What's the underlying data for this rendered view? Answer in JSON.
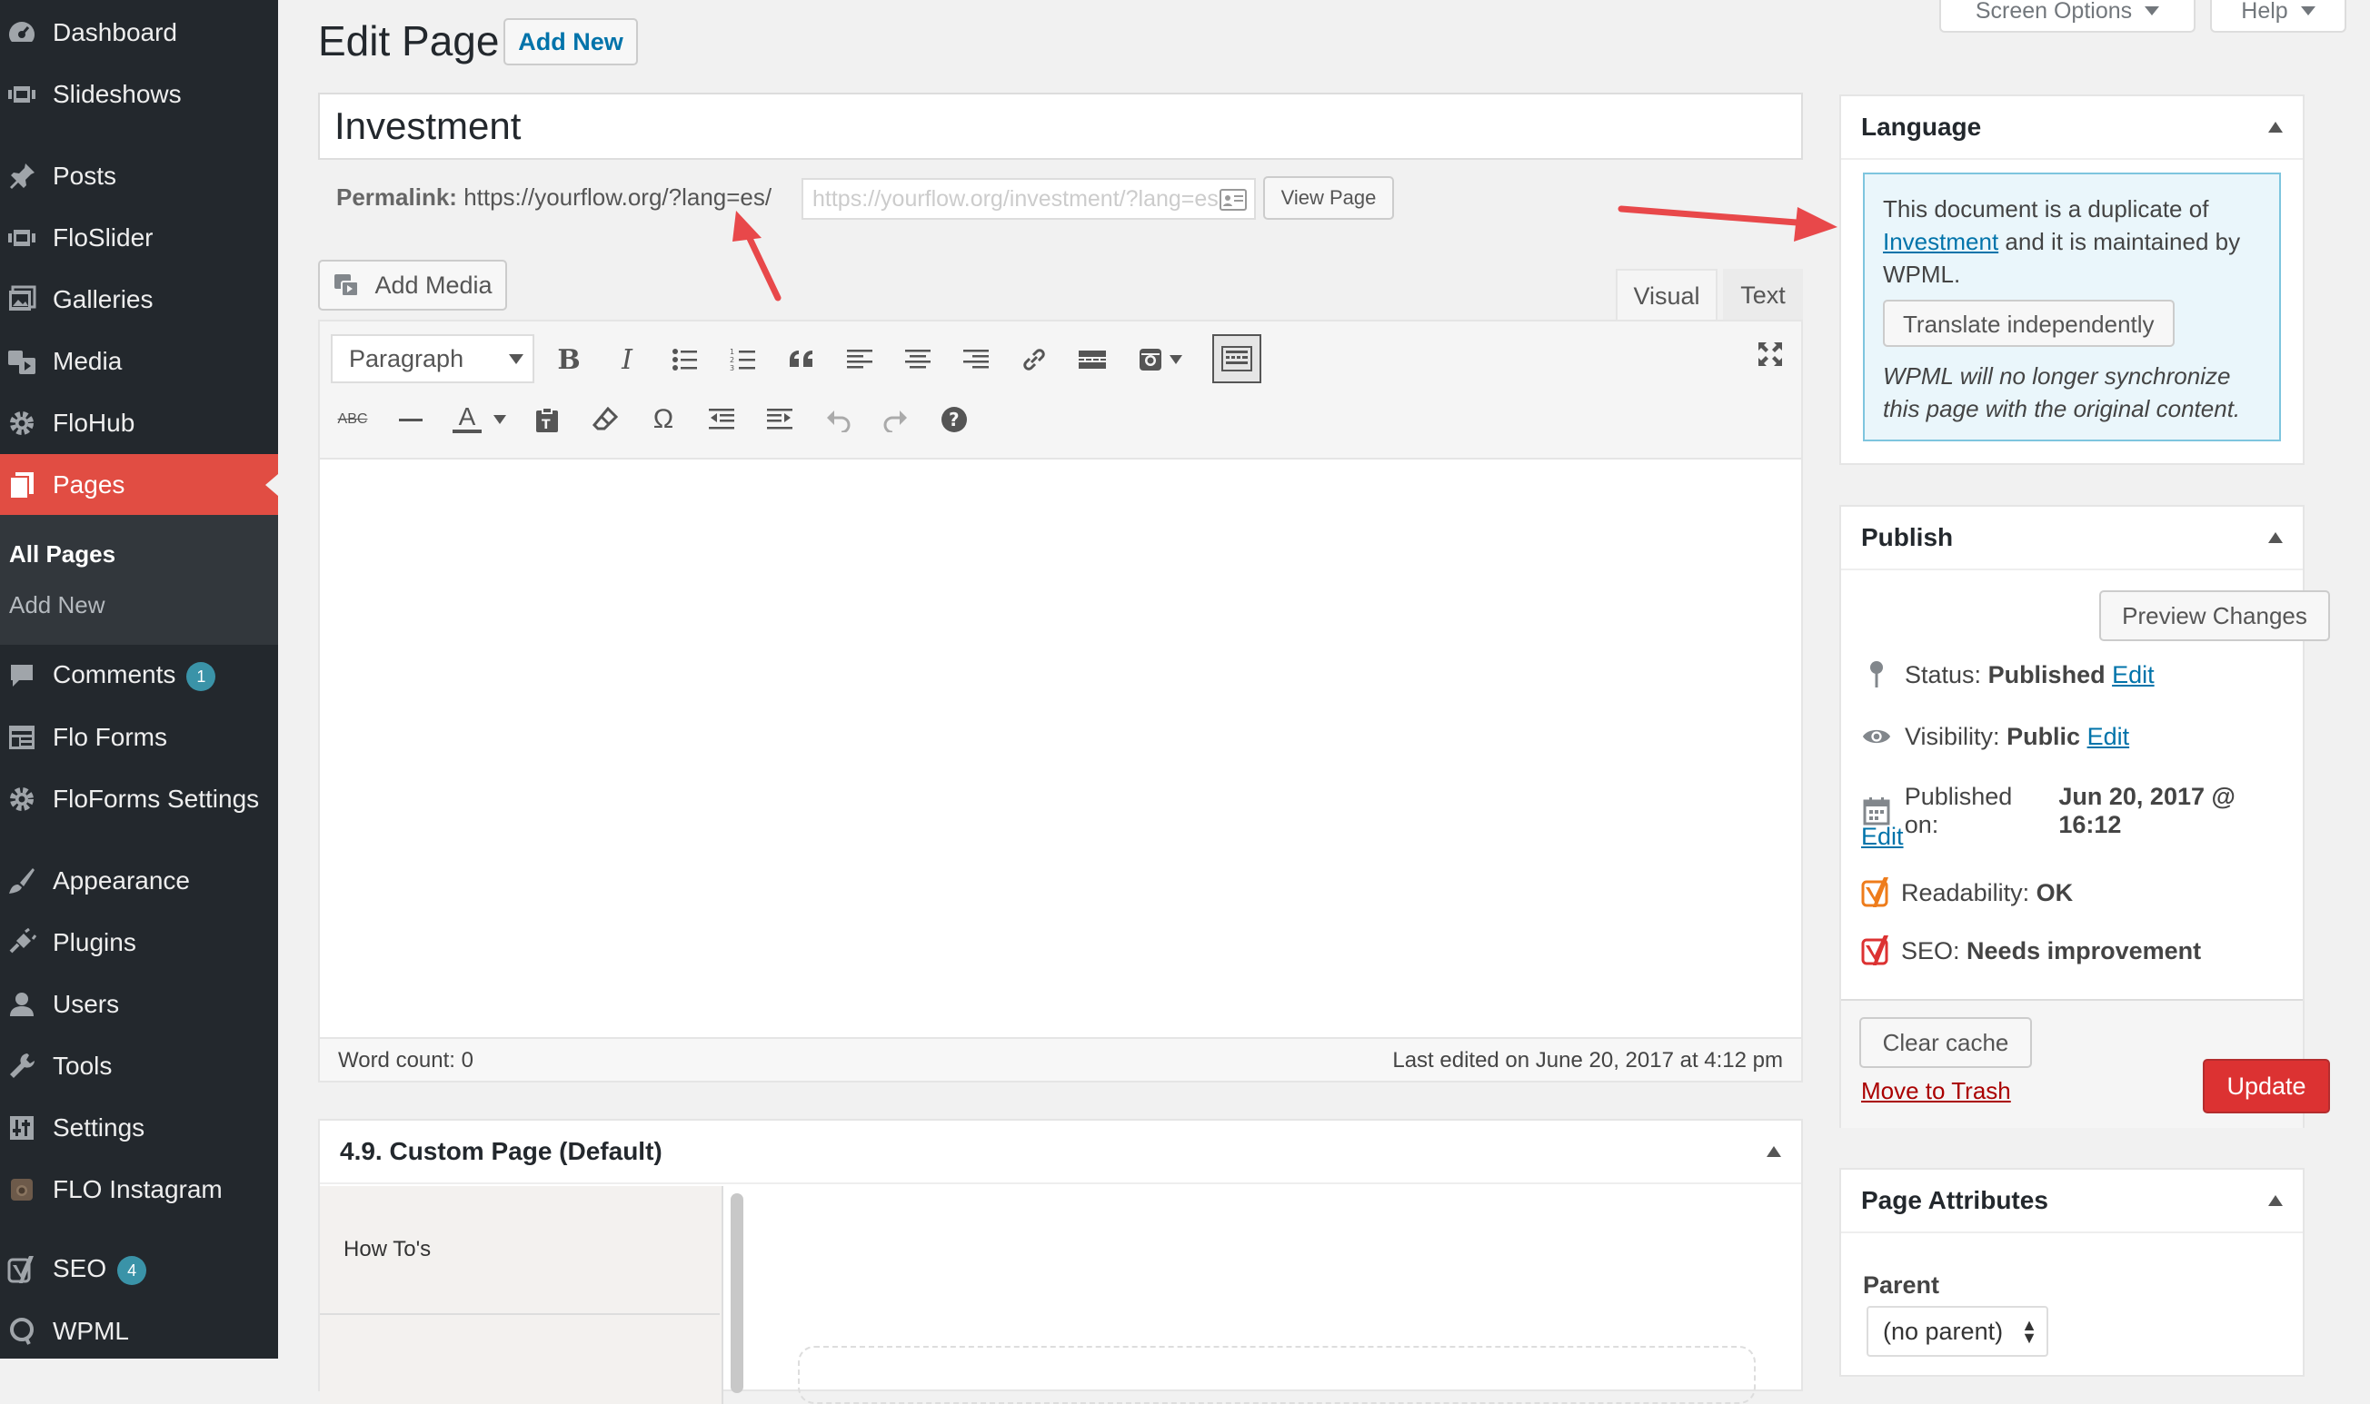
{
  "sidebar": {
    "items": [
      {
        "label": "Dashboard",
        "icon": "dashboard-icon"
      },
      {
        "label": "Slideshows",
        "icon": "slideshow-icon"
      },
      {
        "label": "Posts",
        "icon": "pin-icon"
      },
      {
        "label": "FloSlider",
        "icon": "slider-icon"
      },
      {
        "label": "Galleries",
        "icon": "gallery-icon"
      },
      {
        "label": "Media",
        "icon": "media-icon"
      },
      {
        "label": "FloHub",
        "icon": "gear-icon"
      },
      {
        "label": "Pages",
        "icon": "pages-icon"
      },
      {
        "label": "Comments",
        "icon": "comment-icon",
        "badge": "1"
      },
      {
        "label": "Flo Forms",
        "icon": "forms-icon"
      },
      {
        "label": "FloForms Settings",
        "icon": "gear-icon"
      },
      {
        "label": "Appearance",
        "icon": "brush-icon"
      },
      {
        "label": "Plugins",
        "icon": "plug-icon"
      },
      {
        "label": "Users",
        "icon": "user-icon"
      },
      {
        "label": "Tools",
        "icon": "wrench-icon"
      },
      {
        "label": "Settings",
        "icon": "settings-icon"
      },
      {
        "label": "FLO Instagram",
        "icon": "instagram-icon"
      },
      {
        "label": "SEO",
        "icon": "yoast-icon",
        "badge": "4"
      },
      {
        "label": "WPML",
        "icon": "wpml-icon"
      }
    ],
    "submenu": {
      "all_pages": "All Pages",
      "add_new": "Add New"
    }
  },
  "header": {
    "title": "Edit Page",
    "add_new": "Add New",
    "screen_options": "Screen Options",
    "help": "Help"
  },
  "post": {
    "title": "Investment",
    "permalink_label": "Permalink:",
    "permalink_url": "https://yourflow.org/?lang=es/",
    "slug_placeholder": "https://yourflow.org/investment/?lang=es",
    "view_page": "View Page"
  },
  "editor": {
    "add_media": "Add Media",
    "tab_visual": "Visual",
    "tab_text": "Text",
    "format_select": "Paragraph",
    "word_count": "Word count: 0",
    "last_edited": "Last edited on June 20, 2017 at 4:12 pm"
  },
  "custom_page": {
    "title": "4.9. Custom Page (Default)",
    "list_item": "How To's"
  },
  "language_box": {
    "title": "Language",
    "notice_pre": "This document is a duplicate of",
    "notice_link": "Investment",
    "notice_post": "and it is maintained by WPML.",
    "translate_button": "Translate independently",
    "warning": "WPML will no longer synchronize this page with the original content."
  },
  "publish_box": {
    "title": "Publish",
    "preview": "Preview Changes",
    "status_label": "Status:",
    "status_value": "Published",
    "visibility_label": "Visibility:",
    "visibility_value": "Public",
    "published_label": "Published on:",
    "published_value": "Jun 20, 2017 @ 16:12",
    "edit": "Edit",
    "readability_label": "Readability:",
    "readability_value": "OK",
    "seo_label": "SEO:",
    "seo_value": "Needs improvement",
    "clear_cache": "Clear cache",
    "trash": "Move to Trash",
    "update": "Update"
  },
  "attributes_box": {
    "title": "Page Attributes",
    "parent_label": "Parent",
    "parent_value": "(no parent)"
  },
  "colors": {
    "accent": "#e14d43",
    "link": "#0073aa",
    "update_button": "#dc3232",
    "annotation_arrow": "#e8484a"
  }
}
